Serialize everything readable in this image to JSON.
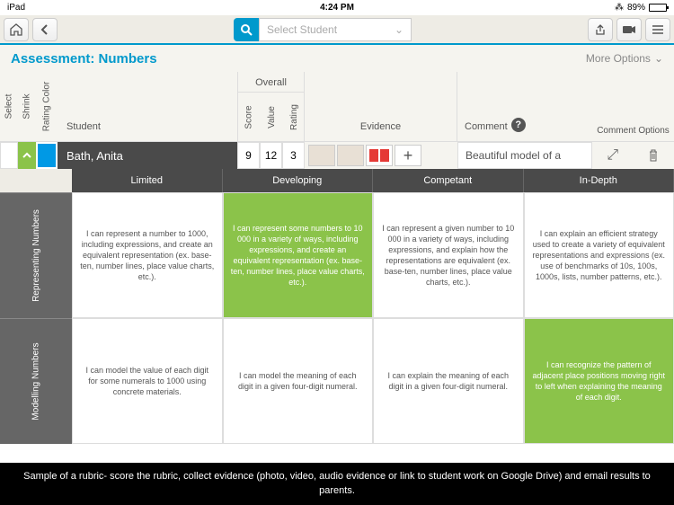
{
  "status": {
    "device": "iPad",
    "wifi": "wifi-icon",
    "time": "4:24 PM",
    "bt": "bluetooth-icon",
    "battery_pct": "89%"
  },
  "topbar": {
    "select_student": "Select Student"
  },
  "header": {
    "title": "Assessment: Numbers",
    "more": "More Options"
  },
  "cols": {
    "select": "Select",
    "shrink": "Shrink",
    "rating_color": "Rating Color",
    "student": "Student",
    "overall": "Overall",
    "score": "Score",
    "value": "Value",
    "rating": "Rating",
    "evidence": "Evidence",
    "comment": "Comment",
    "comment_options": "Comment Options"
  },
  "student": {
    "name": "Bath, Anita",
    "score": "9",
    "value": "12",
    "rating": "3",
    "comment": "Beautiful model of a"
  },
  "levels": [
    "Limited",
    "Developing",
    "Competant",
    "In-Depth"
  ],
  "criteria": [
    {
      "name": "Representing Numbers",
      "selected": 1,
      "cells": [
        "I can represent a number to 1000, including expressions, and create an equivalent representation (ex. base-ten, number lines, place value charts, etc.).",
        "I can represent some numbers to 10 000 in a variety of ways, including expressions, and create an equivalent representation (ex. base-ten, number lines, place value charts, etc.).",
        "I can represent a given number to 10 000 in a variety of ways, including expressions, and explain how the representations are equivalent (ex. base-ten, number lines, place value charts, etc.).",
        "I can explain an efficient strategy used to create a variety of equivalent representations and expressions (ex. use of benchmarks of 10s, 100s, 1000s, lists, number patterns, etc.)."
      ]
    },
    {
      "name": "Modelling Numbers",
      "selected": 3,
      "cells": [
        "I can model the value of each digit for some numerals to 1000 using concrete materials.",
        "I can model the meaning of each digit in a given four-digit numeral.",
        "I can explain the meaning of each digit in a given four-digit numeral.",
        "I can recognize the pattern of adjacent place positions moving right to left when explaining the meaning of each digit."
      ]
    }
  ],
  "caption": "Sample of a rubric- score the rubric, collect evidence (photo, video, audio evidence or link to student work on Google Drive) and email results to parents."
}
